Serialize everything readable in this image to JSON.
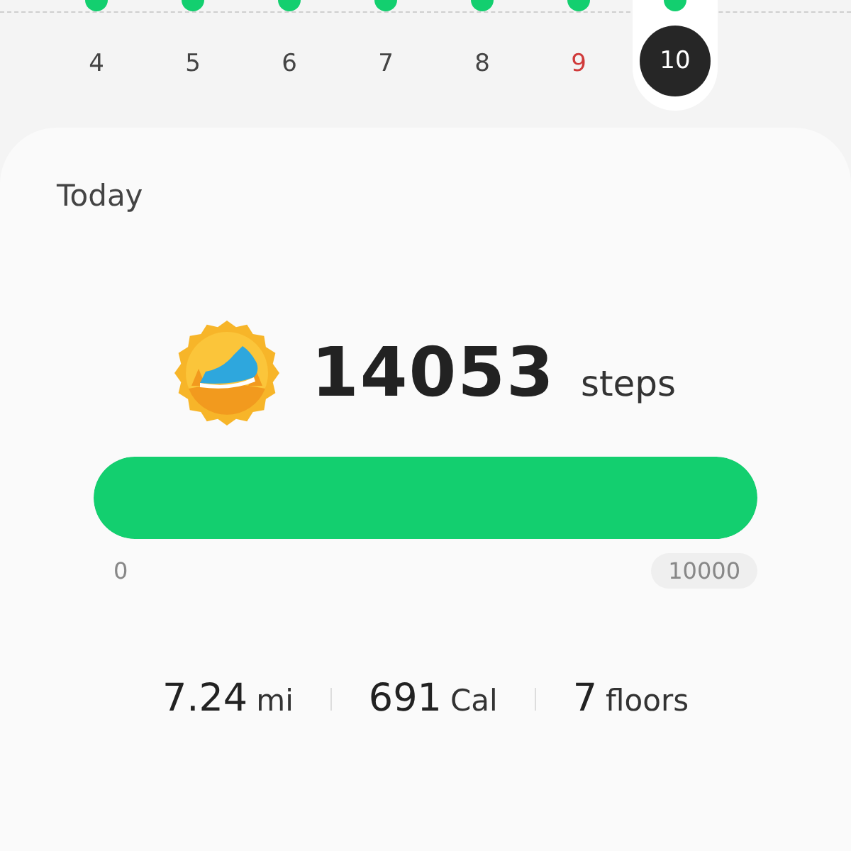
{
  "days": [
    {
      "label": "4",
      "selected": false,
      "weekend": false,
      "goal_met": true
    },
    {
      "label": "5",
      "selected": false,
      "weekend": false,
      "goal_met": true
    },
    {
      "label": "6",
      "selected": false,
      "weekend": false,
      "goal_met": true
    },
    {
      "label": "7",
      "selected": false,
      "weekend": false,
      "goal_met": true
    },
    {
      "label": "8",
      "selected": false,
      "weekend": false,
      "goal_met": true
    },
    {
      "label": "9",
      "selected": false,
      "weekend": true,
      "goal_met": true
    },
    {
      "label": "10",
      "selected": true,
      "weekend": false,
      "goal_met": true
    }
  ],
  "card": {
    "title": "Today",
    "steps": "14053",
    "steps_unit": "steps",
    "progress": {
      "level": 1,
      "min_label": "0",
      "goal_label": "10000"
    },
    "stats": [
      {
        "value": "7.24",
        "unit": "mi"
      },
      {
        "value": "691",
        "unit": "Cal"
      },
      {
        "value": "7",
        "unit": "floors"
      }
    ]
  }
}
